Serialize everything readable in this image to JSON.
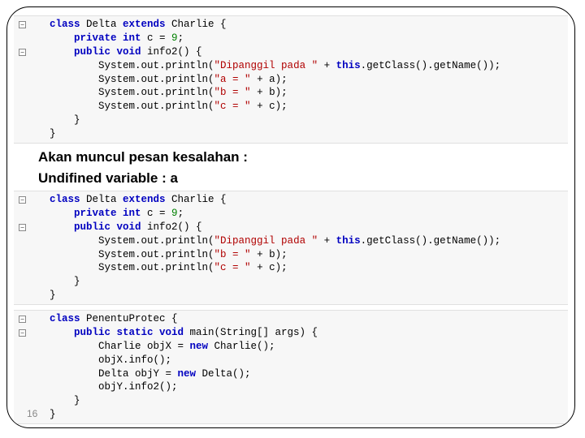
{
  "block1": {
    "l1a": "class",
    "l1b": " Delta ",
    "l1c": "extends",
    "l1d": " Charlie {",
    "l2a": "    private int",
    "l2b": " c = ",
    "l2c": "9",
    "l2d": ";",
    "l3a": "    public void",
    "l3b": " info2() {",
    "l4a": "        System.out.println(",
    "l4b": "\"Dipanggil pada \"",
    "l4c": " + ",
    "l4d": "this",
    "l4e": ".getClass().getName());",
    "l5a": "        System.out.println(",
    "l5b": "\"a = \"",
    "l5c": " + a);",
    "l6a": "        System.out.println(",
    "l6b": "\"b = \"",
    "l6c": " + b);",
    "l7a": "        System.out.println(",
    "l7b": "\"c = \"",
    "l7c": " + c);",
    "l8": "    }",
    "l9": "}"
  },
  "explain1": "Akan muncul pesan kesalahan :",
  "explain2": "Undifined variable : a",
  "block2": {
    "l1a": "class",
    "l1b": " Delta ",
    "l1c": "extends",
    "l1d": " Charlie {",
    "l2a": "    private int",
    "l2b": " c = ",
    "l2c": "9",
    "l2d": ";",
    "l3a": "    public void",
    "l3b": " info2() {",
    "l4a": "        System.out.println(",
    "l4b": "\"Dipanggil pada \"",
    "l4c": " + ",
    "l4d": "this",
    "l4e": ".getClass().getName());",
    "l5a": "        System.out.println(",
    "l5b": "\"b = \"",
    "l5c": " + b);",
    "l6a": "        System.out.println(",
    "l6b": "\"c = \"",
    "l6c": " + c);",
    "l7": "    }",
    "l8": "}"
  },
  "block3": {
    "l1a": "class",
    "l1b": " PenentuProtec {",
    "l2a": "    public static void",
    "l2b": " main(String[] args) {",
    "l3a": "        Charlie objX = ",
    "l3b": "new",
    "l3c": " Charlie();",
    "l4": "        objX.info();",
    "l5a": "        Delta objY = ",
    "l5b": "new",
    "l5c": " Delta();",
    "l6": "        objY.info2();",
    "l7": "    }",
    "l8": "}"
  },
  "page_num": "16"
}
